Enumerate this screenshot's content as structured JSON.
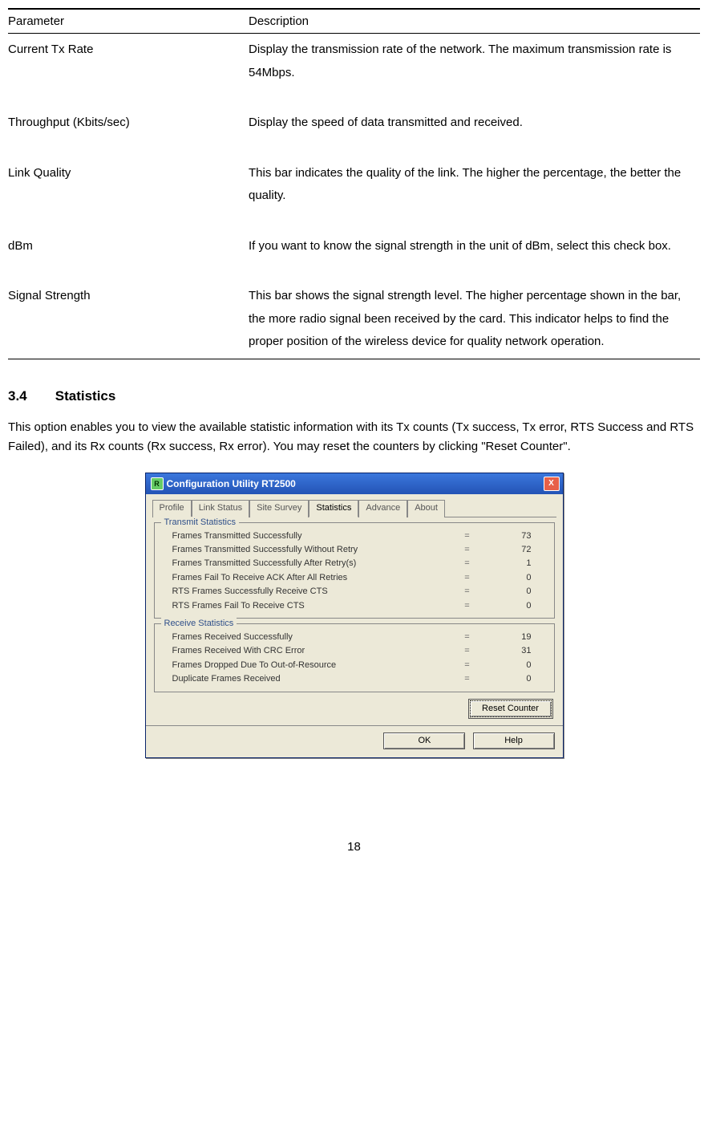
{
  "table": {
    "headers": {
      "param": "Parameter",
      "desc": "Description"
    },
    "rows": [
      {
        "param": "Current Tx Rate",
        "desc": "Display the transmission rate of the network. The maximum transmission rate is 54Mbps."
      },
      {
        "param": "Throughput (Kbits/sec)",
        "desc": "Display the speed of data transmitted and received."
      },
      {
        "param": "Link Quality",
        "desc": "This bar indicates the quality of the link. The higher the percentage, the better the quality."
      },
      {
        "param": "dBm",
        "desc": "If you want to know the signal strength in the unit of dBm, select this check box."
      },
      {
        "param": "Signal Strength",
        "desc": "This bar shows the signal strength level. The higher percentage shown in the bar, the more radio signal been  received by the card. This indicator helps to find the proper position of the wireless device for quality network operation."
      }
    ]
  },
  "section": {
    "number": "3.4",
    "title": "Statistics",
    "body": "This option enables you to view the available statistic information with its Tx counts (Tx success, Tx error, RTS Success and RTS Failed), and its Rx counts (Rx success, Rx error). You may reset the counters by clicking \"Reset Counter\"."
  },
  "dialog": {
    "title": "Configuration Utility RT2500",
    "icon_letter": "R",
    "tabs": [
      "Profile",
      "Link Status",
      "Site Survey",
      "Statistics",
      "Advance",
      "About"
    ],
    "active_tab_index": 3,
    "transmit": {
      "title": "Transmit Statistics",
      "rows": [
        {
          "label": "Frames Transmitted Successfully",
          "value": "73"
        },
        {
          "label": "Frames Transmitted Successfully Without Retry",
          "value": "72"
        },
        {
          "label": "Frames Transmitted Successfully After Retry(s)",
          "value": "1"
        },
        {
          "label": "Frames Fail To Receive ACK After All Retries",
          "value": "0"
        },
        {
          "label": "RTS Frames Successfully Receive CTS",
          "value": "0"
        },
        {
          "label": "RTS Frames Fail To Receive CTS",
          "value": "0"
        }
      ]
    },
    "receive": {
      "title": "Receive Statistics",
      "rows": [
        {
          "label": "Frames Received Successfully",
          "value": "19"
        },
        {
          "label": "Frames Received With CRC Error",
          "value": "31"
        },
        {
          "label": "Frames Dropped Due To Out-of-Resource",
          "value": "0"
        },
        {
          "label": "Duplicate Frames Received",
          "value": "0"
        }
      ]
    },
    "buttons": {
      "reset": "Reset Counter",
      "ok": "OK",
      "help": "Help"
    }
  },
  "page_number": "18"
}
